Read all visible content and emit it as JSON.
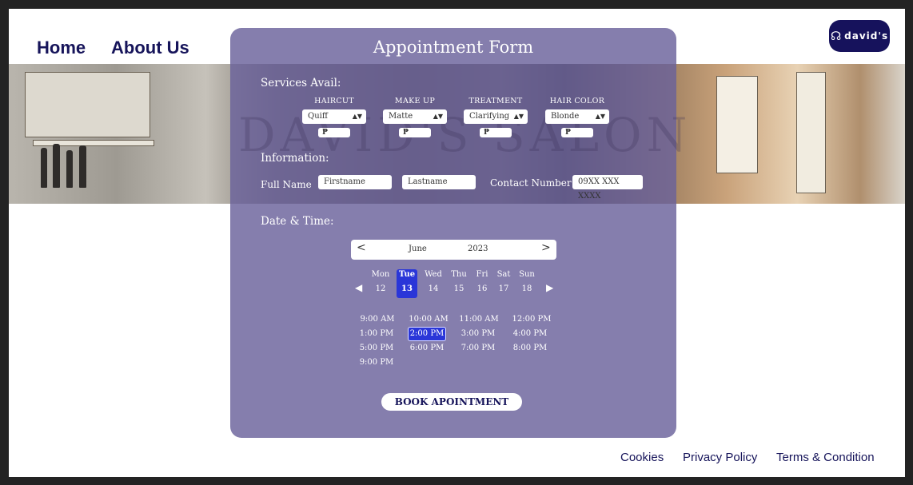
{
  "nav": {
    "home": "Home",
    "about": "About Us"
  },
  "logo": {
    "text": "david's"
  },
  "form": {
    "title": "Appointment Form",
    "watermark": "DAVID'S SALON",
    "services_label": "Services Avail:",
    "services": [
      {
        "heading": "HAIRCUT",
        "selected": "Quiff",
        "price": "₱"
      },
      {
        "heading": "MAKE UP",
        "selected": "Matte",
        "price": "₱"
      },
      {
        "heading": "TREATMENT",
        "selected": "Clarifying",
        "price": "₱"
      },
      {
        "heading": "HAIR COLOR",
        "selected": "Blonde",
        "price": "₱"
      }
    ],
    "information_label": "Information:",
    "full_name_label": "Full Name",
    "firstname_placeholder": "Firstname",
    "lastname_placeholder": "Lastname",
    "contact_label": "Contact Number",
    "contact_placeholder": "09XX XXX XXXX",
    "datetime_label": "Date & Time:",
    "calendar": {
      "prev": "<",
      "next": ">",
      "month": "June",
      "year": "2023",
      "days": [
        {
          "name": "Mon",
          "date": "12"
        },
        {
          "name": "Tue",
          "date": "13"
        },
        {
          "name": "Wed",
          "date": "14"
        },
        {
          "name": "Thu",
          "date": "15"
        },
        {
          "name": "Fri",
          "date": "16"
        },
        {
          "name": "Sat",
          "date": "17"
        },
        {
          "name": "Sun",
          "date": "18"
        }
      ],
      "selected_day": "Tue"
    },
    "time_slots": [
      "9:00 AM",
      "10:00 AM",
      "11:00 AM",
      "12:00 PM",
      "1:00 PM",
      "2:00 PM",
      "3:00 PM",
      "4:00 PM",
      "5:00 PM",
      "6:00 PM",
      "7:00 PM",
      "8:00 PM",
      "9:00 PM"
    ],
    "selected_slot": "2:00 PM",
    "book_label": "BOOK APOINTMENT"
  },
  "footer": {
    "cookies": "Cookies",
    "privacy": "Privacy Policy",
    "terms": "Terms & Condition"
  },
  "colors": {
    "brand": "#16145a",
    "panel": "#6a629b",
    "accent": "#2a36d8"
  }
}
